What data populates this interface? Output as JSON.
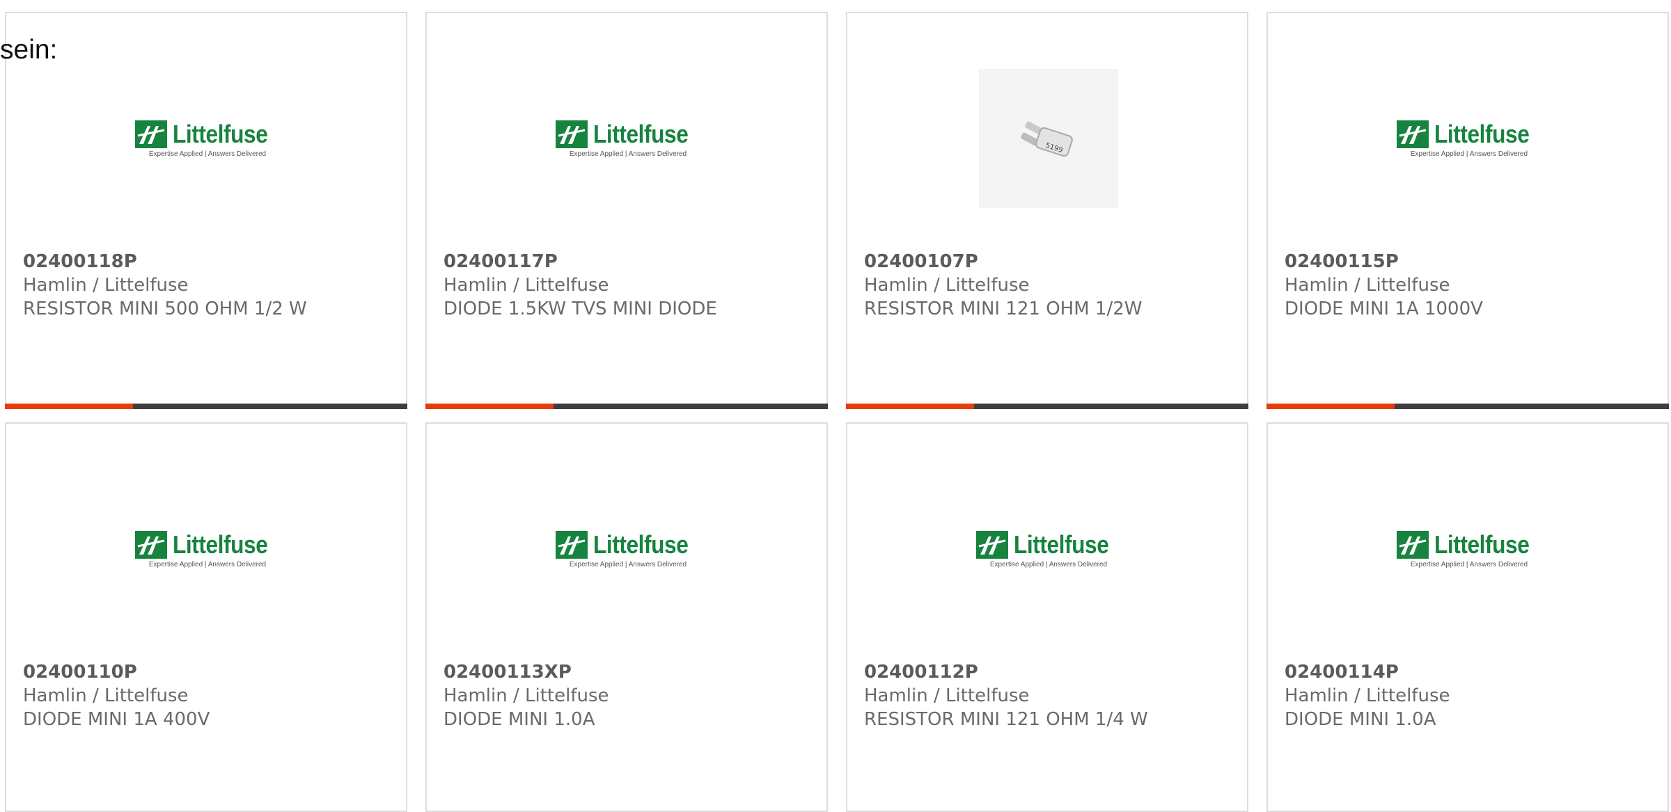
{
  "intro_text": "sein:",
  "logo": {
    "wordmark": "Littelfuse",
    "tagline": "Expertise Applied | Answers Delivered"
  },
  "colors": {
    "brand_green": "#16833f",
    "accent_orange": "#e63c0c",
    "bar_dark": "#3d3d3d"
  },
  "products": [
    {
      "part": "02400118P",
      "manufacturer": "Hamlin / Littelfuse",
      "description": "RESISTOR MINI 500 OHM 1/2 W",
      "image": "littelfuse-logo"
    },
    {
      "part": "02400117P",
      "manufacturer": "Hamlin / Littelfuse",
      "description": "DIODE 1.5KW TVS MINI DIODE",
      "image": "littelfuse-logo"
    },
    {
      "part": "02400107P",
      "manufacturer": "Hamlin / Littelfuse",
      "description": "RESISTOR MINI 121 OHM 1/2W",
      "image": "product-photo"
    },
    {
      "part": "02400115P",
      "manufacturer": "Hamlin / Littelfuse",
      "description": "DIODE MINI 1A 1000V",
      "image": "littelfuse-logo"
    },
    {
      "part": "02400110P",
      "manufacturer": "Hamlin / Littelfuse",
      "description": "DIODE MINI 1A 400V",
      "image": "littelfuse-logo"
    },
    {
      "part": "02400113XP",
      "manufacturer": "Hamlin / Littelfuse",
      "description": "DIODE MINI 1.0A",
      "image": "littelfuse-logo"
    },
    {
      "part": "02400112P",
      "manufacturer": "Hamlin / Littelfuse",
      "description": "RESISTOR MINI 121 OHM 1/4 W",
      "image": "littelfuse-logo"
    },
    {
      "part": "02400114P",
      "manufacturer": "Hamlin / Littelfuse",
      "description": "DIODE MINI 1.0A",
      "image": "littelfuse-logo"
    }
  ]
}
